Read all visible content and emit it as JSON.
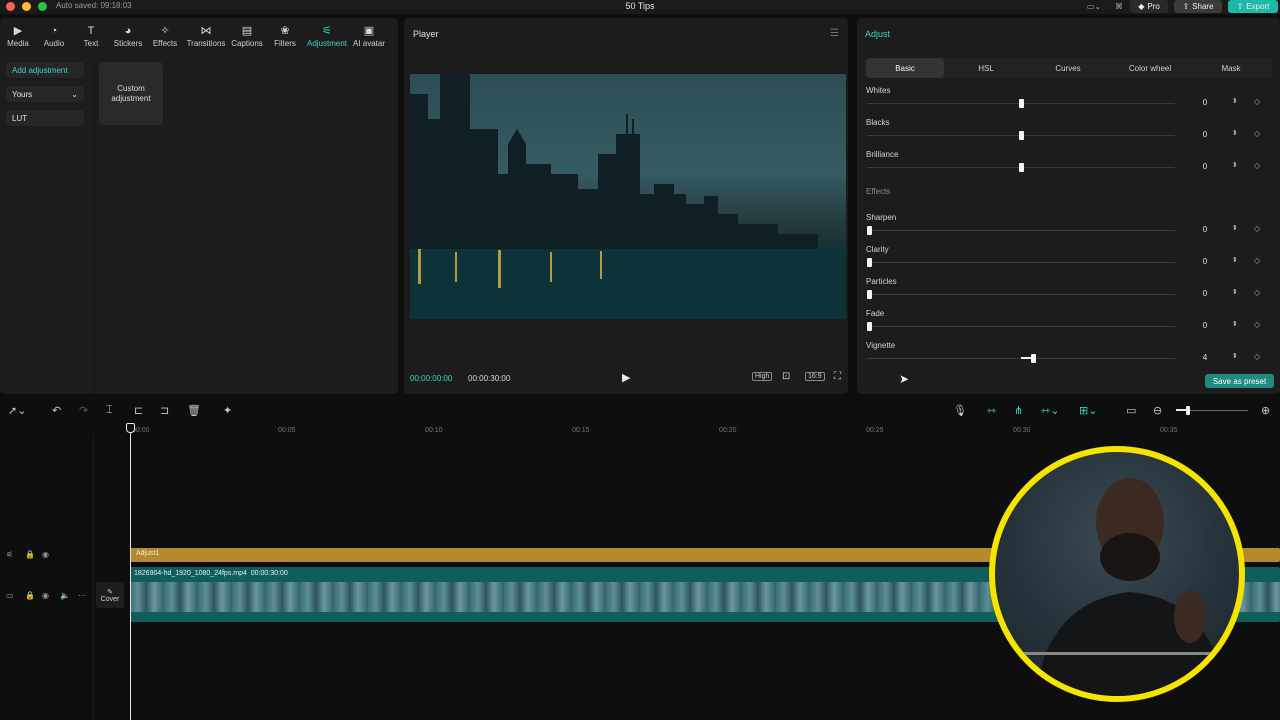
{
  "titlebar": {
    "autosave": "Auto saved: 09:18:03",
    "title": "50 Tips",
    "pro_label": "Pro",
    "share_label": "Share",
    "export_label": "Export"
  },
  "toolbar_tabs": [
    {
      "label": "Media",
      "icon": "media-icon"
    },
    {
      "label": "Audio",
      "icon": "audio-icon"
    },
    {
      "label": "Text",
      "icon": "text-icon"
    },
    {
      "label": "Stickers",
      "icon": "stickers-icon"
    },
    {
      "label": "Effects",
      "icon": "effects-icon"
    },
    {
      "label": "Transitions",
      "icon": "transitions-icon"
    },
    {
      "label": "Captions",
      "icon": "captions-icon"
    },
    {
      "label": "Filters",
      "icon": "filters-icon"
    },
    {
      "label": "Adjustment",
      "icon": "adjustment-icon",
      "active": true
    },
    {
      "label": "AI avatar",
      "icon": "ai-avatar-icon"
    }
  ],
  "left_sidebar": {
    "add_adjustment": "Add adjustment",
    "yours": "Yours",
    "lut": "LUT",
    "custom_card": "Custom adjustment"
  },
  "player": {
    "title": "Player",
    "current_time": "00:00:00:00",
    "total_time": "00:00:30:00",
    "quality": "High",
    "ratio": "16:9"
  },
  "adjust": {
    "title": "Adjust",
    "tabs": [
      "Basic",
      "HSL",
      "Curves",
      "Color wheel",
      "Mask"
    ],
    "active_tab": "Basic",
    "params_top": [
      {
        "label": "Whites",
        "value": "0",
        "level": 0.5
      },
      {
        "label": "Blacks",
        "value": "0",
        "level": 0.5
      },
      {
        "label": "Brilliance",
        "value": "0",
        "level": 0.5
      }
    ],
    "effects_heading": "Effects",
    "params_effects": [
      {
        "label": "Sharpen",
        "value": "0",
        "level": 0
      },
      {
        "label": "Clarity",
        "value": "0",
        "level": 0
      },
      {
        "label": "Particles",
        "value": "0",
        "level": 0
      },
      {
        "label": "Fade",
        "value": "0",
        "level": 0
      },
      {
        "label": "Vignette",
        "value": "4",
        "level": 0.54
      }
    ],
    "save_preset": "Save as preset"
  },
  "timeline": {
    "ticks": [
      "00:00",
      "00:05",
      "00:10",
      "00:15",
      "00:20",
      "00:25",
      "00:30",
      "00:35"
    ],
    "adjust_clip": "Adjust1",
    "video_clip_name": "1826904-hd_1920_1080_24fps.mp4",
    "video_clip_duration": "00:00:30:00",
    "cover_label": "Cover"
  },
  "colors": {
    "accent": "#3fd3c3",
    "adjust_clip": "#b58a2d",
    "video_clip": "#0f5e5c",
    "webcam_border": "#f5e400"
  }
}
